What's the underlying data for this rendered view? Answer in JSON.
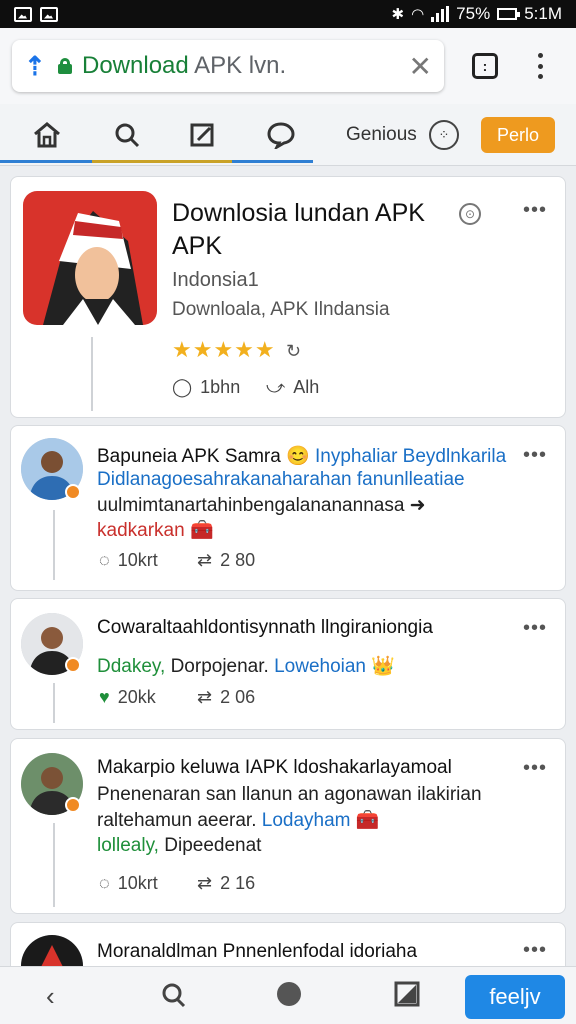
{
  "status_bar": {
    "battery": "75%",
    "time": "5:1M"
  },
  "browser": {
    "url_main": "Download",
    "url_muted": "APK lvn.",
    "tabs_count": ":"
  },
  "nav": {
    "label": "Genious",
    "primary_button": "Perlo"
  },
  "app": {
    "title_line1": "Downlosia lundan APK",
    "title_line2": "APK",
    "subtitle": "Indonsia1",
    "developer": "Downloala, APK Ilndansia",
    "rating": "★★★★★",
    "comments": "1bhn",
    "shares": "Alh"
  },
  "posts": [
    {
      "head": "Bapuneia APK Samra 😊",
      "head_link": "Inyphaliar Beydlnkarila",
      "line1": "Didlanagoesahrakanaharahan fanunlleatiae",
      "line2": "uulmimtanartahinbengalananannasa ➜",
      "line3": "kadkarkan 🧰",
      "replies": "10krt",
      "reposts": "2 80"
    },
    {
      "head": "Cowaraltaahldontisynnath llngiraniongia",
      "line1_green": "Ddakey,",
      "line1_rest": " Dorpojenar.",
      "line1_link": " Lowehoian 👑",
      "replies": "20kk",
      "reposts": "2 06"
    },
    {
      "head": "Makarpio keluwa IAPK ldoshakarlayamoal",
      "line1": "Pnenenaran san llanun an agonawan ilakirian",
      "line2": "raltehamun aeerar.",
      "line2_link": " Lodayham 🧰",
      "line3_green": "lollealy,",
      "line3_rest": " Dipeedenat",
      "replies": "10krt",
      "reposts": "2 16"
    },
    {
      "head": "Moranaldlman Pnnenlenfodal idoriaha"
    }
  ],
  "bottom": {
    "button": "feeljv"
  },
  "colors": {
    "accent_blue": "#1f88e5",
    "accent_orange": "#ee9a1f",
    "url_green": "#188038"
  }
}
